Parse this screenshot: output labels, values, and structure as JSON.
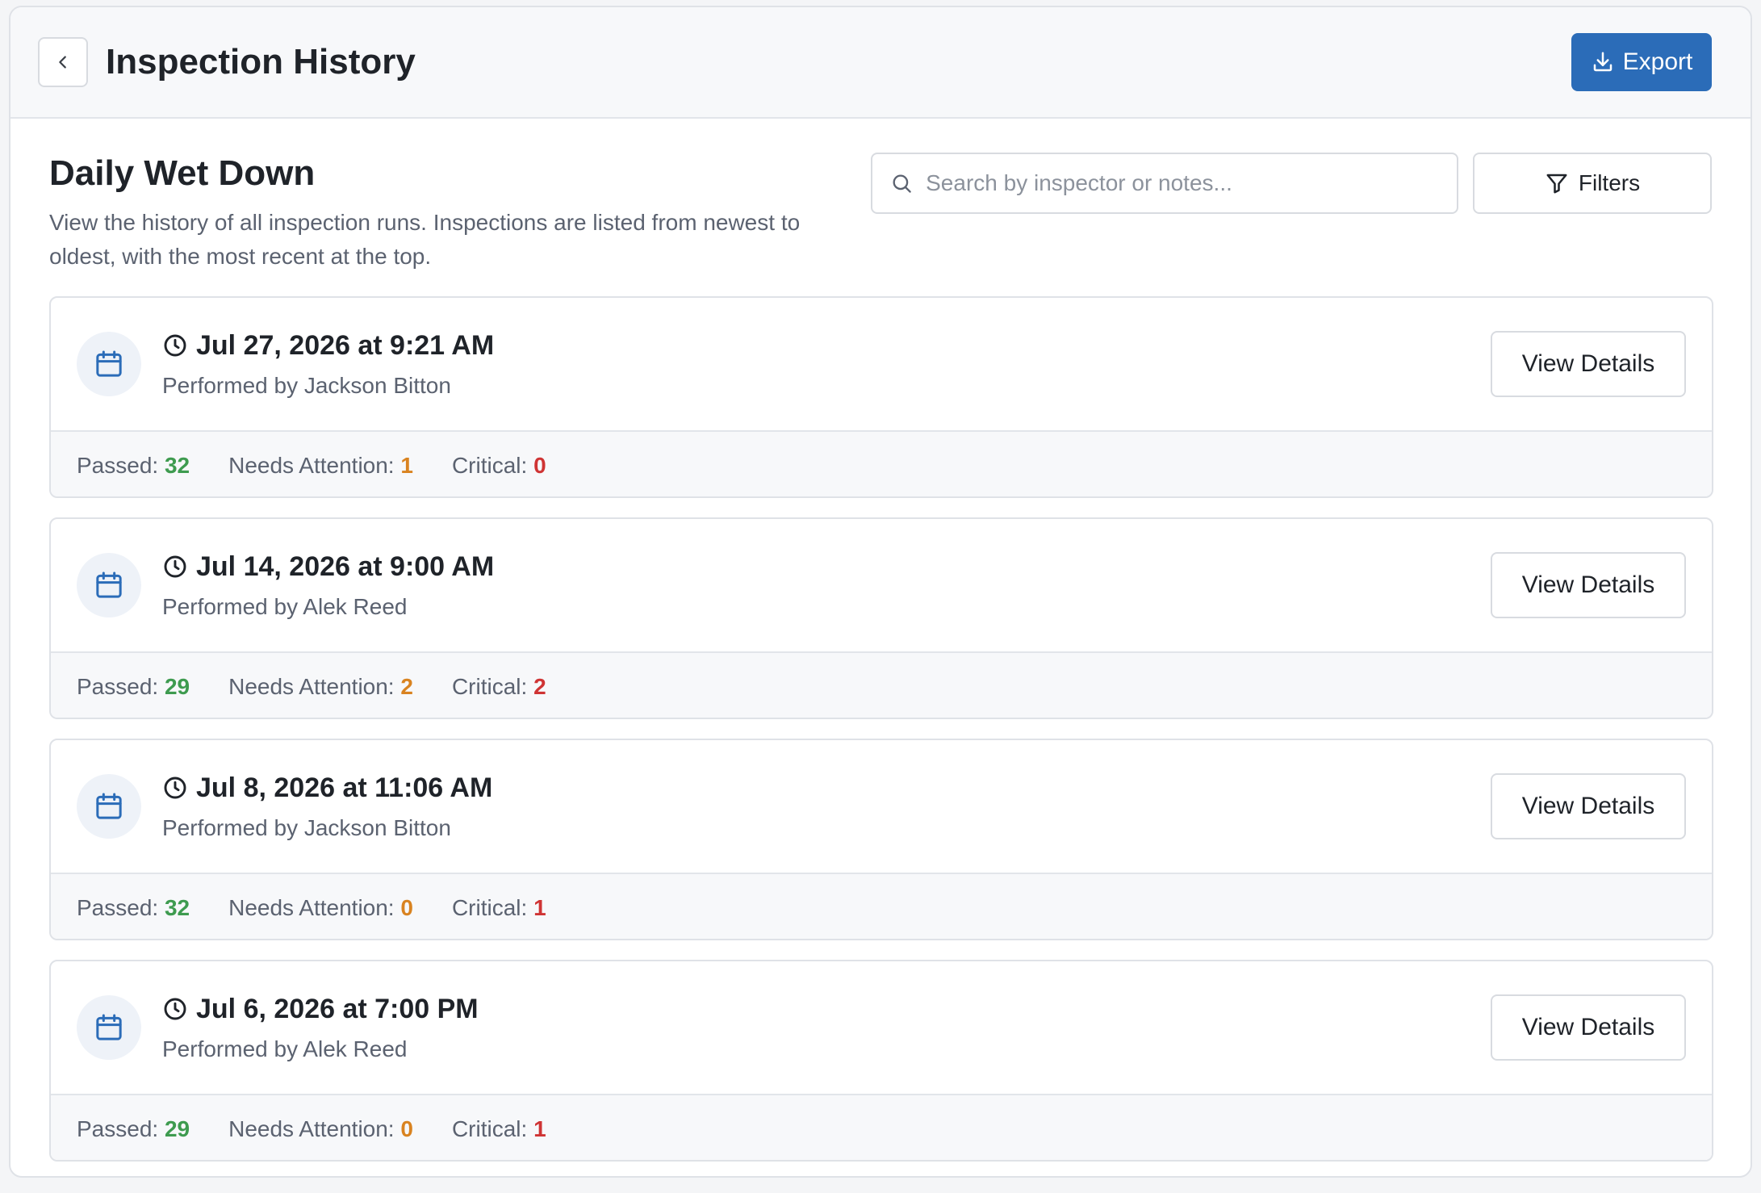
{
  "header": {
    "title": "Inspection History",
    "export_label": "Export"
  },
  "section": {
    "title": "Daily Wet Down",
    "description": "View the history of all inspection runs. Inspections are listed from newest to oldest, with the most recent at the top."
  },
  "search": {
    "placeholder": "Search by inspector or notes...",
    "value": ""
  },
  "filters_label": "Filters",
  "labels": {
    "passed": "Passed:",
    "needs_attention": "Needs Attention:",
    "critical": "Critical:",
    "view_details": "View Details"
  },
  "colors": {
    "accent": "#2b6cb8",
    "passed": "#3e9b4f",
    "needs_attention": "#d98320",
    "critical": "#cf3434"
  },
  "icons": {
    "back": "chevron-left-icon",
    "export": "download-icon",
    "search": "search-icon",
    "filters": "filter-icon",
    "run": "calendar-icon",
    "time": "clock-icon"
  },
  "runs": [
    {
      "date": "Jul 27, 2026 at 9:21 AM",
      "inspector": "Performed by Jackson Bitton",
      "passed": "32",
      "needs_attention": "1",
      "critical": "0"
    },
    {
      "date": "Jul 14, 2026 at 9:00 AM",
      "inspector": "Performed by Alek Reed",
      "passed": "29",
      "needs_attention": "2",
      "critical": "2"
    },
    {
      "date": "Jul 8, 2026 at 11:06 AM",
      "inspector": "Performed by Jackson Bitton",
      "passed": "32",
      "needs_attention": "0",
      "critical": "1"
    },
    {
      "date": "Jul 6, 2026 at 7:00 PM",
      "inspector": "Performed by Alek Reed",
      "passed": "29",
      "needs_attention": "0",
      "critical": "1"
    }
  ]
}
